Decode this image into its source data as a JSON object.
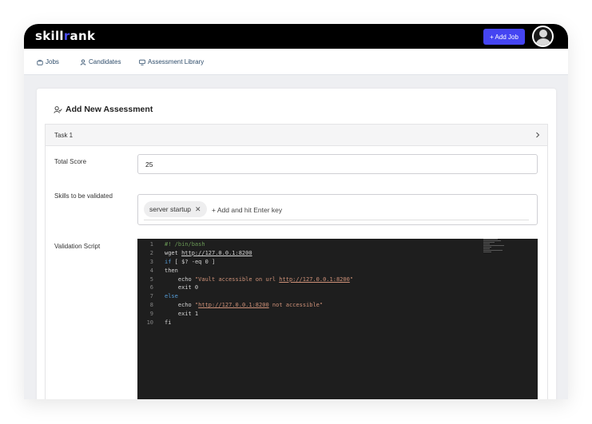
{
  "header": {
    "logo_prefix": "skill",
    "logo_accent": "r",
    "logo_suffix": "ank",
    "add_job_label": "+ Add Job"
  },
  "nav": {
    "items": [
      {
        "label": "Jobs",
        "icon": "briefcase-icon"
      },
      {
        "label": "Candidates",
        "icon": "user-icon"
      },
      {
        "label": "Assessment Library",
        "icon": "monitor-icon"
      }
    ]
  },
  "page": {
    "title": "Add New Assessment",
    "title_icon": "assessment-icon"
  },
  "task": {
    "label": "Task 1"
  },
  "form": {
    "total_score_label": "Total Score",
    "total_score_value": "25",
    "skills_label": "Skills to be validated",
    "skills": [
      "server startup"
    ],
    "skills_placeholder": "+ Add and hit Enter key",
    "script_label": "Validation Script"
  },
  "editor": {
    "line_numbers": [
      "1",
      "2",
      "3",
      "4",
      "5",
      "6",
      "7",
      "8",
      "9",
      "10"
    ],
    "lines": [
      [
        {
          "t": "#! /bin/bash",
          "c": "comment"
        }
      ],
      [
        {
          "t": "wget ",
          "c": "plain"
        },
        {
          "t": "http://127.0.0.1:8200",
          "c": "url"
        }
      ],
      [
        {
          "t": "if",
          "c": "kw"
        },
        {
          "t": " [ $? -eq 0 ]",
          "c": "plain"
        }
      ],
      [
        {
          "t": "then",
          "c": "plain"
        }
      ],
      [
        {
          "t": "    echo ",
          "c": "plain"
        },
        {
          "t": "\"Vault accessible on url ",
          "c": "str"
        },
        {
          "t": "http://127.0.0.1:8200",
          "c": "strurl"
        },
        {
          "t": "\"",
          "c": "str"
        }
      ],
      [
        {
          "t": "    exit 0",
          "c": "plain"
        }
      ],
      [
        {
          "t": "else",
          "c": "kw"
        }
      ],
      [
        {
          "t": "    echo ",
          "c": "plain"
        },
        {
          "t": "\"",
          "c": "str"
        },
        {
          "t": "http://127.0.0.1:8200",
          "c": "strurl"
        },
        {
          "t": " not accessible\"",
          "c": "str"
        }
      ],
      [
        {
          "t": "    exit 1",
          "c": "plain"
        }
      ],
      [
        {
          "t": "fi",
          "c": "plain"
        }
      ]
    ]
  },
  "colors": {
    "accent": "#4545f2",
    "topbar": "#000000",
    "editor_bg": "#1e1e1e"
  }
}
